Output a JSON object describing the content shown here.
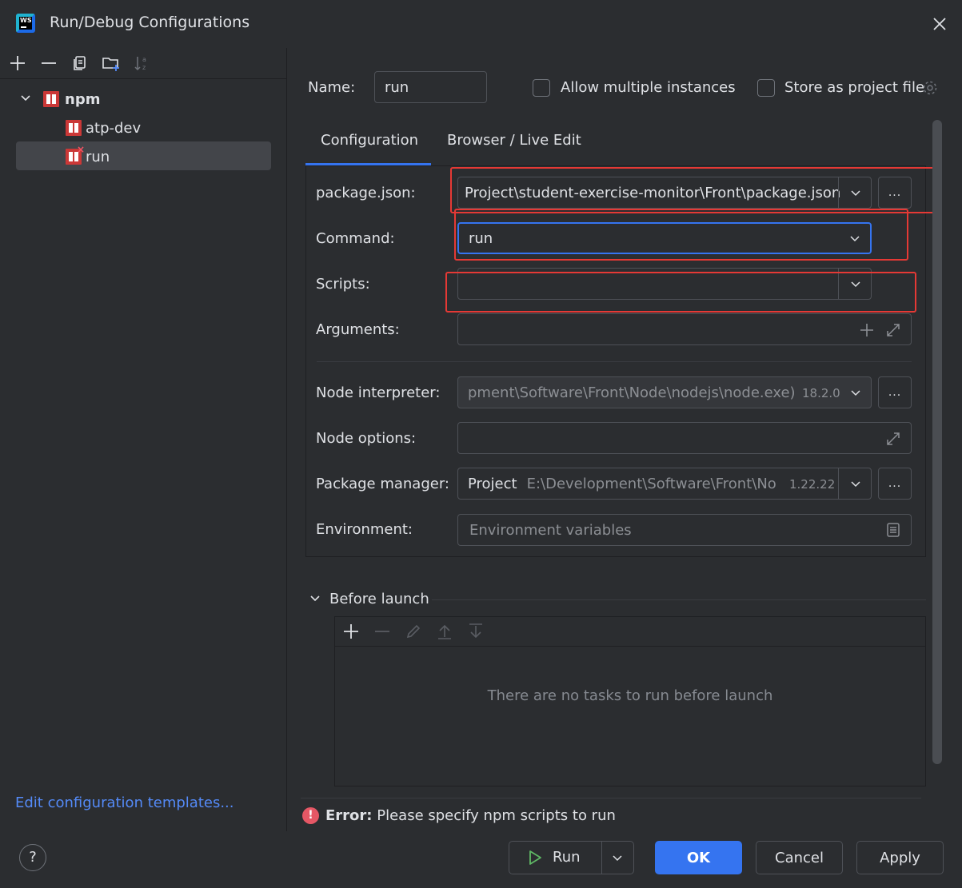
{
  "window": {
    "title": "Run/Debug Configurations"
  },
  "tree": {
    "root_label": "npm",
    "items": [
      {
        "label": "atp-dev"
      },
      {
        "label": "run"
      }
    ]
  },
  "left_footer": {
    "link": "Edit configuration templates..."
  },
  "name_field": {
    "label": "Name:",
    "value": "run"
  },
  "options": {
    "allow_multiple": "Allow multiple instances",
    "store_project": "Store as project file"
  },
  "tabs": [
    {
      "label": "Configuration",
      "active": true
    },
    {
      "label": "Browser / Live Edit",
      "active": false
    }
  ],
  "config": {
    "package_json": {
      "label": "package.json:",
      "value": "Project\\student-exercise-monitor\\Front\\package.json"
    },
    "command": {
      "label": "Command:",
      "value": "run"
    },
    "scripts": {
      "label": "Scripts:",
      "value": ""
    },
    "arguments": {
      "label": "Arguments:",
      "value": ""
    },
    "node_interpreter": {
      "label": "Node interpreter:",
      "value": "pment\\Software\\Front\\Node\\nodejs\\node.exe)",
      "version": "18.2.0"
    },
    "node_options": {
      "label": "Node options:",
      "value": ""
    },
    "package_manager": {
      "label": "Package manager:",
      "prefix": "Project",
      "value": "E:\\Development\\Software\\Front\\Noc",
      "version": "1.22.22"
    },
    "environment": {
      "label": "Environment:",
      "placeholder": "Environment variables"
    }
  },
  "before_launch": {
    "title": "Before launch",
    "empty_text": "There are no tasks to run before launch"
  },
  "status": {
    "error_label": "Error:",
    "error_message": "Please specify npm scripts to run"
  },
  "buttons": {
    "help": "?",
    "run": "Run",
    "ok": "OK",
    "cancel": "Cancel",
    "apply": "Apply"
  },
  "colors": {
    "accent": "#3574f0",
    "error": "#e55765",
    "link": "#548af7",
    "annotation": "#e53935"
  }
}
